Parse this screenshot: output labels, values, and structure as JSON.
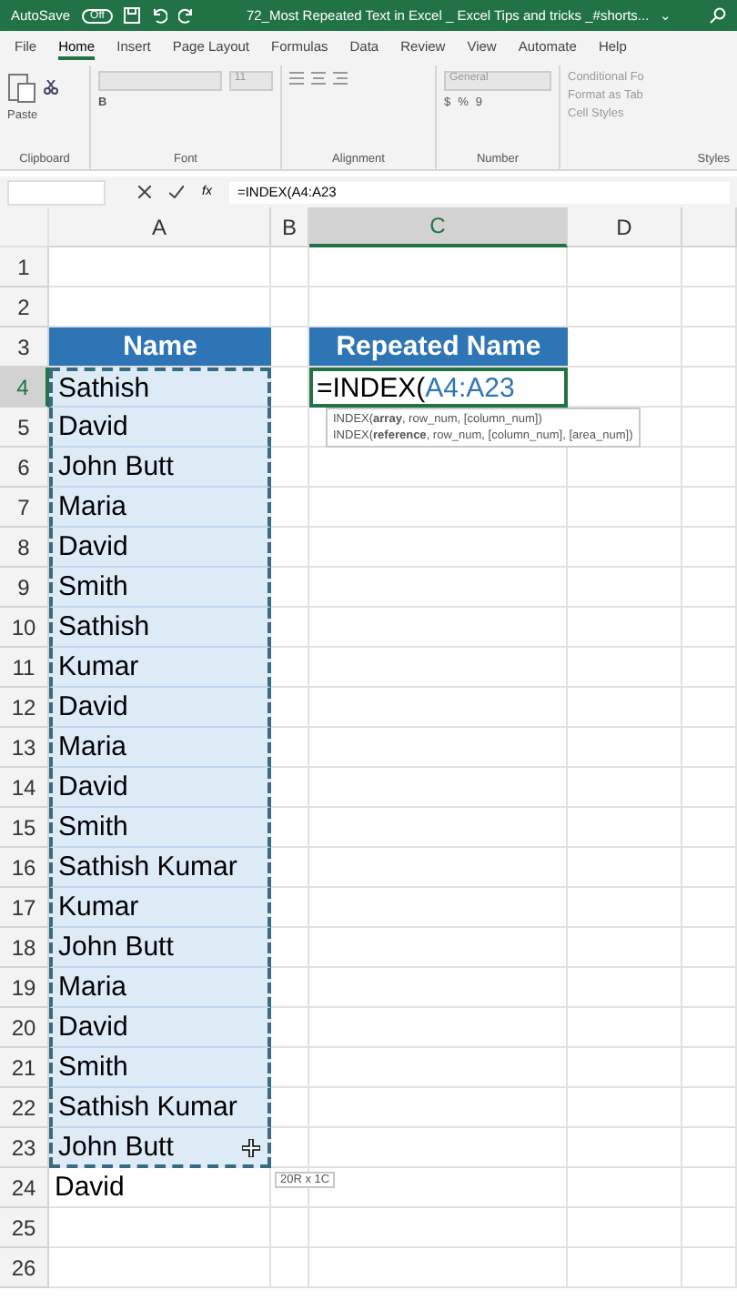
{
  "title_bar": {
    "autosave": "AutoSave",
    "toggle": "Off",
    "toggle_on": false,
    "title": "72_Most Repeated Text in Excel _ Excel Tips and tricks _#shorts...",
    "caret": "⌄"
  },
  "tabs": [
    {
      "label": "File",
      "selected": false
    },
    {
      "label": "Home",
      "selected": true
    },
    {
      "label": "Insert",
      "selected": false
    },
    {
      "label": "Page Layout",
      "selected": false
    },
    {
      "label": "Formulas",
      "selected": false
    },
    {
      "label": "Data",
      "selected": false
    },
    {
      "label": "Review",
      "selected": false
    },
    {
      "label": "View",
      "selected": false
    },
    {
      "label": "Automate",
      "selected": false
    },
    {
      "label": "Help",
      "selected": false
    }
  ],
  "ribbon": {
    "paste": "Paste",
    "font_size": "11",
    "number_format": "General",
    "currency": "$",
    "percent": "%",
    "comma": "9",
    "bold": "B",
    "styles": [
      "Conditional Fo",
      "Format as Tab",
      "Cell Styles"
    ],
    "groups": [
      "Clipboard",
      "Font",
      "Alignment",
      "Number",
      "Styles"
    ]
  },
  "formula_bar": {
    "fx": "fx",
    "formula": "=INDEX(A4:A23"
  },
  "sheet": {
    "columns": [
      {
        "label": "A",
        "selected": false
      },
      {
        "label": "B",
        "selected": false
      },
      {
        "label": "C",
        "selected": true
      },
      {
        "label": "D",
        "selected": false
      }
    ],
    "rows": [
      {
        "label": "1",
        "selected": false
      },
      {
        "label": "2",
        "selected": false
      },
      {
        "label": "3",
        "selected": false
      },
      {
        "label": "4",
        "selected": true
      },
      {
        "label": "5",
        "selected": false
      },
      {
        "label": "6",
        "selected": false
      },
      {
        "label": "7",
        "selected": false
      },
      {
        "label": "8",
        "selected": false
      },
      {
        "label": "9",
        "selected": false
      },
      {
        "label": "10",
        "selected": false
      },
      {
        "label": "11",
        "selected": false
      },
      {
        "label": "12",
        "selected": false
      },
      {
        "label": "13",
        "selected": false
      },
      {
        "label": "14",
        "selected": false
      },
      {
        "label": "15",
        "selected": false
      },
      {
        "label": "16",
        "selected": false
      },
      {
        "label": "17",
        "selected": false
      },
      {
        "label": "18",
        "selected": false
      },
      {
        "label": "19",
        "selected": false
      },
      {
        "label": "20",
        "selected": false
      },
      {
        "label": "21",
        "selected": false
      },
      {
        "label": "22",
        "selected": false
      },
      {
        "label": "23",
        "selected": false
      },
      {
        "label": "24",
        "selected": false
      },
      {
        "label": "25",
        "selected": false
      },
      {
        "label": "26",
        "selected": false
      }
    ],
    "name_header": "Name",
    "repeated_header": "Repeated Name",
    "names": [
      {
        "text": "Sathish",
        "in_range": true
      },
      {
        "text": "David",
        "in_range": true
      },
      {
        "text": "John Butt",
        "in_range": true
      },
      {
        "text": "Maria",
        "in_range": true
      },
      {
        "text": "David",
        "in_range": true
      },
      {
        "text": "Smith",
        "in_range": true
      },
      {
        "text": "Sathish",
        "in_range": true
      },
      {
        "text": "Kumar",
        "in_range": true
      },
      {
        "text": "David",
        "in_range": true
      },
      {
        "text": "Maria",
        "in_range": true
      },
      {
        "text": "David",
        "in_range": true
      },
      {
        "text": "Smith",
        "in_range": true
      },
      {
        "text": "Sathish Kumar",
        "in_range": true
      },
      {
        "text": "Kumar",
        "in_range": true
      },
      {
        "text": "John Butt",
        "in_range": true
      },
      {
        "text": "Maria",
        "in_range": true
      },
      {
        "text": "David",
        "in_range": true
      },
      {
        "text": "Smith",
        "in_range": true
      },
      {
        "text": "Sathish Kumar",
        "in_range": true
      },
      {
        "text": "John Butt",
        "in_range": true
      },
      {
        "text": "David",
        "in_range": false
      }
    ],
    "edit_cell": {
      "prefix": "=INDEX(",
      "range": "A4:A23"
    },
    "tooltip": [
      "INDEX(**array**, row_num, [column_num])",
      "INDEX(**reference**, row_num, [column_num], [area_num])"
    ],
    "size_tip": "20R x 1C"
  }
}
